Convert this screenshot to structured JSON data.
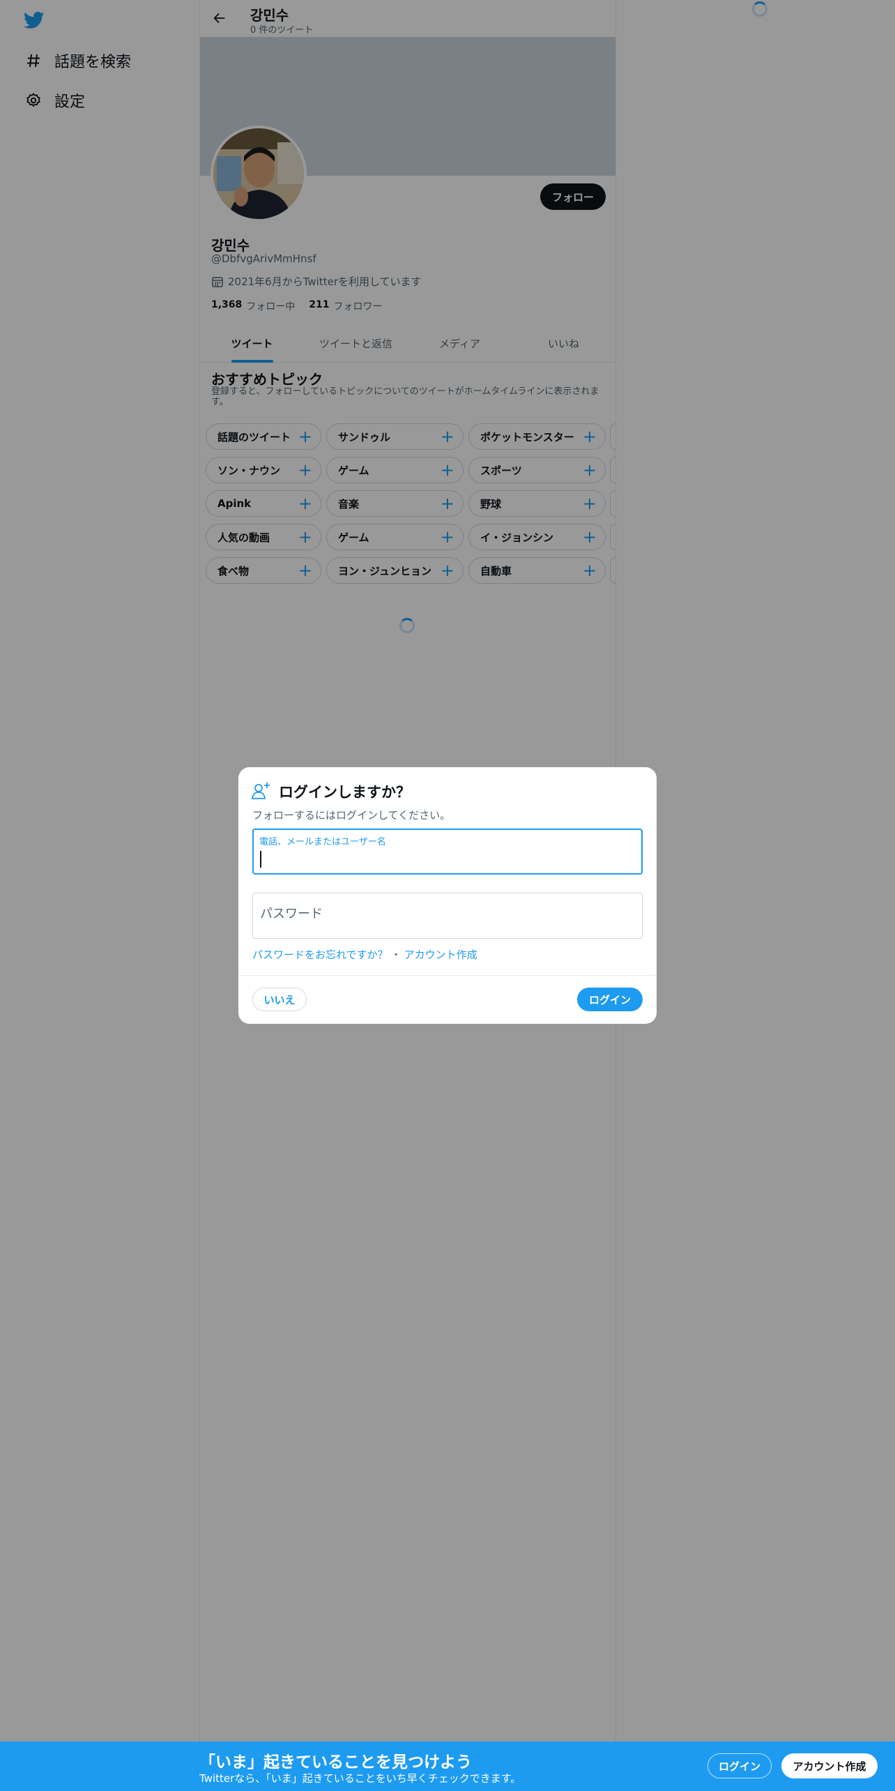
{
  "nav": {
    "items": [
      {
        "label": "話題を検索",
        "icon": "hashtag-icon"
      },
      {
        "label": "設定",
        "icon": "gear-icon"
      }
    ]
  },
  "header": {
    "name": "강민수",
    "tweet_count": "0 件のツイート"
  },
  "profile": {
    "follow_label": "フォロー",
    "name": "강민수",
    "handle": "@DbfvgArivMmHnsf",
    "joined": "2021年6月からTwitterを利用しています",
    "following_count": "1,368",
    "following_label": "フォロー中",
    "followers_count": "211",
    "followers_label": "フォロワー"
  },
  "tabs": [
    "ツイート",
    "ツイートと返信",
    "メディア",
    "いいね"
  ],
  "topics": {
    "title": "おすすめトピック",
    "subtitle": "登録すると、フォローしているトピックについてのツイートがホームタイムラインに表示されます。",
    "rows": [
      [
        "話題のツイート",
        "サンドゥル",
        "ポケットモンスター"
      ],
      [
        "ソン・ナウン",
        "ゲーム",
        "スポーツ"
      ],
      [
        "Apink",
        "音楽",
        "野球"
      ],
      [
        "人気の動画",
        "ゲーム",
        "イ・ジョンシン"
      ],
      [
        "食べ物",
        "ヨン・ジュンヒョン",
        "自動車"
      ]
    ]
  },
  "modal": {
    "title": "ログインしますか？",
    "subtitle": "フォローするにはログインしてください。",
    "username_label": "電話、メールまたはユーザー名",
    "password_placeholder": "パスワード",
    "forgot_link": "パスワードをお忘れですか？",
    "separator": "・",
    "signup_link": "アカウント作成",
    "no_button": "いいえ",
    "login_button": "ログイン"
  },
  "bottom_bar": {
    "title": "「いま」起きていることを見つけよう",
    "subtitle": "Twitterなら、「いま」起きていることをいち早くチェックできます。",
    "login_button": "ログイン",
    "signup_button": "アカウント作成"
  },
  "colors": {
    "accent": "#1d9bf0",
    "text": "#0f1419",
    "secondary": "#536471",
    "banner": "#ccd6dd"
  }
}
